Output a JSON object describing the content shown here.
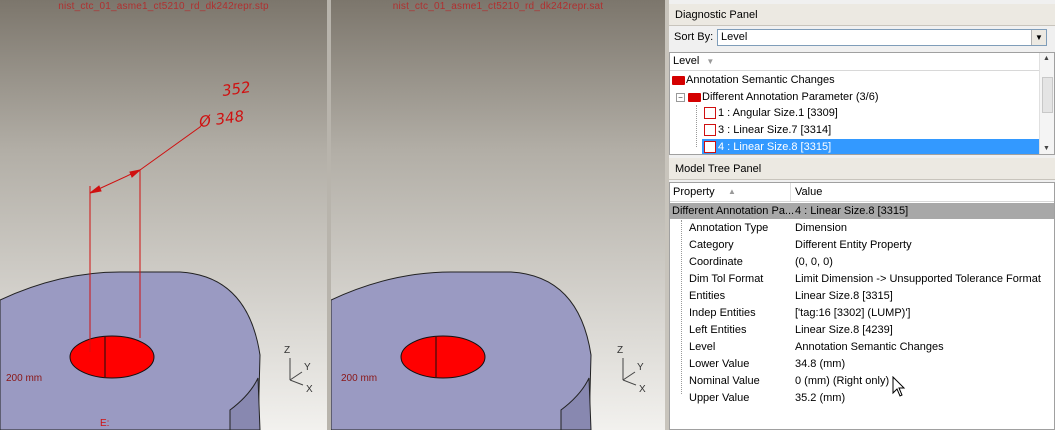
{
  "viewports": {
    "left": {
      "file_title": "nist_ctc_01_asme1_ct5210_rd_dk242repr.stp",
      "scale": "200 mm",
      "dim_upper": "352",
      "dim_diameter": "Ø 348",
      "partial_label": "E:"
    },
    "right": {
      "file_title": "nist_ctc_01_asme1_ct5210_rd_dk242repr.sat",
      "scale": "200 mm"
    },
    "axes": {
      "z": "Z",
      "y": "Y",
      "x": "X"
    },
    "colors": {
      "part_face": "#9a9ac2",
      "hole": "#ff0000",
      "annotation": "#d01010"
    }
  },
  "diagnostic_panel": {
    "title": "Diagnostic Panel",
    "sort_label": "Sort By:",
    "sort_value": "Level",
    "column": "Level",
    "tree": [
      {
        "label": "Annotation Semantic Changes"
      },
      {
        "label": "Different Annotation Parameter (3/6)"
      },
      {
        "label": "1 : Angular Size.1 [3309]"
      },
      {
        "label": "3 : Linear Size.7 [3314]"
      },
      {
        "label": "4 : Linear Size.8 [3315]"
      }
    ]
  },
  "model_tree_panel": {
    "title": "Model Tree Panel",
    "col_property": "Property",
    "col_value": "Value",
    "group": {
      "key": "Different Annotation Pa...",
      "value": "4 : Linear Size.8 [3315]"
    },
    "rows": [
      {
        "key": "Annotation Type",
        "value": "Dimension"
      },
      {
        "key": "Category",
        "value": "Different Entity Property"
      },
      {
        "key": "Coordinate",
        "value": "(0, 0, 0)"
      },
      {
        "key": "Dim Tol Format",
        "value": "Limit Dimension -> Unsupported Tolerance Format"
      },
      {
        "key": "Entities",
        "value": "Linear Size.8 [3315]"
      },
      {
        "key": "Indep Entities",
        "value": "['tag:16 [3302] (LUMP)']"
      },
      {
        "key": "Left Entities",
        "value": "Linear Size.8 [4239]"
      },
      {
        "key": "Level",
        "value": "Annotation Semantic Changes"
      },
      {
        "key": "Lower Value",
        "value": "34.8 (mm)"
      },
      {
        "key": "Nominal Value",
        "value": "0 (mm) (Right only)"
      },
      {
        "key": "Upper Value",
        "value": "35.2 (mm)"
      }
    ]
  }
}
